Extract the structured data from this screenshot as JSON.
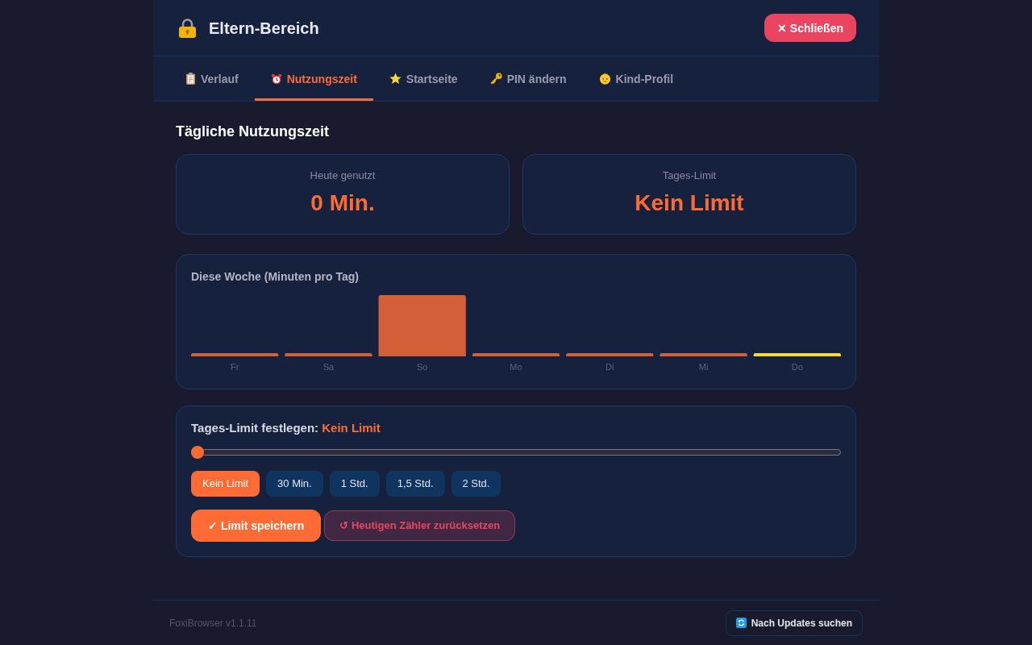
{
  "header": {
    "title": "Eltern-Bereich",
    "close_button": "✕ Schließen"
  },
  "tabs": [
    {
      "label": "Verlauf",
      "kind": "clipboard",
      "selected": false
    },
    {
      "label": "Nutzungszeit",
      "kind": "alarm",
      "selected": true
    },
    {
      "label": "Startseite",
      "kind": "star",
      "selected": false
    },
    {
      "label": "PIN ändern",
      "kind": "key",
      "selected": false
    },
    {
      "label": "Kind-Profil",
      "kind": "baby",
      "selected": false
    }
  ],
  "section_title": "Tägliche Nutzungszeit",
  "stats": [
    {
      "label": "Heute genutzt",
      "value": "0 Min."
    },
    {
      "label": "Tages-Limit",
      "value": "Kein Limit"
    }
  ],
  "weekly_chart": {
    "title": "Diese Woche (Minuten pro Tag)",
    "days": [
      {
        "label": "Fr",
        "today": false
      },
      {
        "label": "Sa",
        "today": false
      },
      {
        "label": "So",
        "today": false
      },
      {
        "label": "Mo",
        "today": false
      },
      {
        "label": "Di",
        "today": false
      },
      {
        "label": "Mi",
        "today": false
      },
      {
        "label": "Do",
        "today": true
      }
    ]
  },
  "limit_setting": {
    "label": "Tages-Limit festlegen:",
    "value": "Kein Limit",
    "slider": {
      "level": 0
    },
    "presets": [
      {
        "label": "Kein Limit",
        "selected": true
      },
      {
        "label": "30 Min.",
        "selected": false
      },
      {
        "label": "1 Std.",
        "selected": false
      },
      {
        "label": "1,5 Std.",
        "selected": false
      },
      {
        "label": "2 Std.",
        "selected": false
      }
    ],
    "save_button": "✓ Limit speichern",
    "reset_button": "↺ Heutigen Zähler zurücksetzen"
  },
  "footer": {
    "version": "FoxiBrowser v1.1.11",
    "update_button": "Nach Updates suchen"
  }
}
